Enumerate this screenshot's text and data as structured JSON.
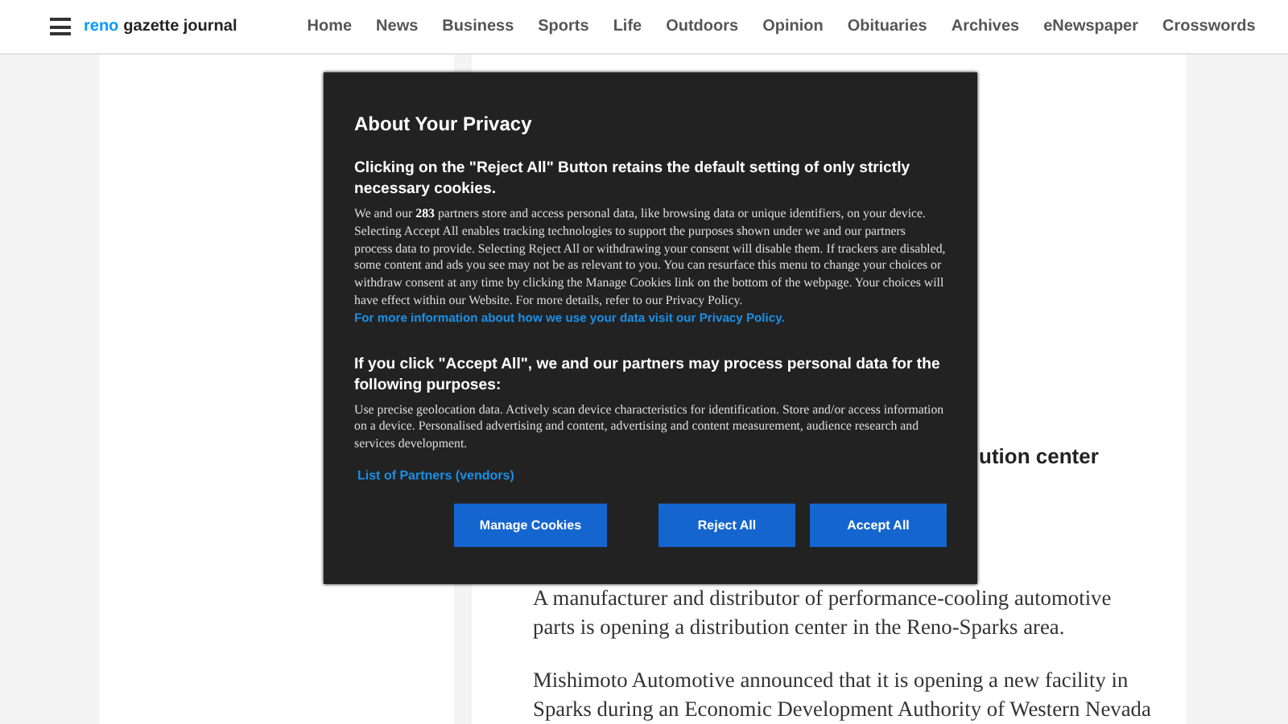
{
  "header": {
    "logo": [
      {
        "text": "reno",
        "kind": "accent"
      },
      {
        "text": "gazette journal",
        "kind": "plain"
      }
    ],
    "nav": [
      "Home",
      "News",
      "Business",
      "Sports",
      "Life",
      "Outdoors",
      "Opinion",
      "Obituaries",
      "Archives",
      "eNewspaper",
      "Crosswords"
    ]
  },
  "article": {
    "headline": "ution center",
    "paragraphs": [
      "A manufacturer and distributor of performance-cooling automotive parts is opening a distribution center in the Reno-Sparks area.",
      "Mishimoto Automotive announced that it is opening a new facility in Sparks during an Economic Development Authority of Western Nevada"
    ]
  },
  "privacy_dialog": {
    "title": "About Your Privacy",
    "heading_1": "Clicking on the \"Reject All\" Button retains the default setting of only strictly necessary cookies.",
    "body_1": "We and our **283** partners store and access personal data, like browsing data or unique identifiers, on your device. Selecting Accept All enables tracking technologies to support the purposes shown under we and our partners process data to provide. Selecting Reject All or withdrawing your consent will disable them. If trackers are disabled, some content and ads you see may not be as relevant to you. You can resurface this menu to change your choices or withdraw consent at any time by clicking the Manage Cookies link on the bottom of the webpage. Your choices will have effect within our Website. For more details, refer to our Privacy Policy.",
    "body_1_link": "For more information about how we use your data visit our Privacy Policy.",
    "heading_2": "If you click \"Accept All\", we and our partners may process personal data for the following purposes:",
    "body_2": "Use precise geolocation data. Actively scan device characteristics for identification. Store and/or access information on a device. Personalised advertising and content, advertising and content measurement, audience research and services development.",
    "partners_link": "List of Partners (vendors)",
    "buttons": [
      {
        "label": "Manage Cookies",
        "kind": "left"
      },
      {
        "label": "Reject All",
        "kind": "right"
      },
      {
        "label": "Accept All",
        "kind": "right"
      }
    ]
  }
}
